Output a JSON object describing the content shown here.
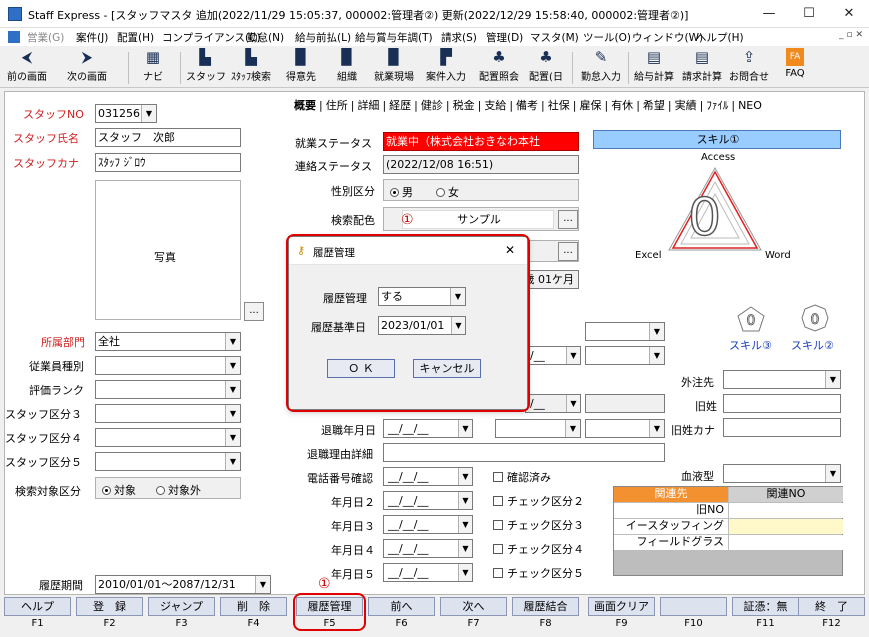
{
  "window": {
    "title": "Staff Express - [スタッフマスタ 追加(2022/11/29 15:05:37, 000002:管理者②) 更新(2022/12/29 15:58:40, 000002:管理者②)]",
    "minimize": "—",
    "maximize": "☐",
    "close": "✕"
  },
  "menu": {
    "items": [
      "営業(G)",
      "案件(J)",
      "配置(H)",
      "コンプライアンス(C)",
      "勤怠(N)",
      "給与前払(L)",
      "給与賞与年調(T)",
      "請求(S)",
      "管理(D)",
      "マスタ(M)",
      "ツール(O)",
      "ウィンドウ(W)",
      "ヘルプ(H)"
    ],
    "mdi_controls": "_ ▫ ✕"
  },
  "toolbar": {
    "prev": "前の画面",
    "next": "次の画面",
    "navi": "ナビ",
    "staff": "スタッフ",
    "staff_search": "ｽﾀｯﾌ検索",
    "client": "得意先",
    "org": "組織",
    "site": "就業現場",
    "job_entry": "案件入力",
    "assign_view": "配置照会",
    "assign_day": "配置(日",
    "attendance": "勤怠入力",
    "payroll": "給与計算",
    "billing": "請求計算",
    "inquiry": "お問合せ",
    "faq": "FAQ"
  },
  "left": {
    "staff_no_label": "スタッフNO",
    "staff_no": "031256",
    "staff_name_label": "スタッフ氏名",
    "staff_name": "スタッフ　次郎",
    "staff_kana_label": "スタッフカナ",
    "staff_kana": "ｽﾀｯﾌ ｼﾞﾛｳ",
    "photo_label": "写真",
    "photo_btn": "...",
    "dept_label": "所属部門",
    "dept": "全社",
    "emp_type_label": "従業員種別",
    "eval_rank_label": "評価ランク",
    "staff_cat3_label": "スタッフ区分３",
    "staff_cat4_label": "スタッフ区分４",
    "staff_cat5_label": "スタッフ区分５",
    "search_target_label": "検索対象区分",
    "search_target_on": "対象",
    "search_target_off": "対象外",
    "history_period_label": "履歴期間",
    "history_period": "2010/01/01～2087/12/31"
  },
  "tabs": [
    "概要",
    "住所",
    "詳細",
    "経歴",
    "健診",
    "税金",
    "支給",
    "備考",
    "社保",
    "雇保",
    "有休",
    "希望",
    "実績",
    "ﾌｧｲﾙ",
    "NEO"
  ],
  "center": {
    "work_status_label": "就業ステータス",
    "work_status": "就業中（株式会社おきなわ本社",
    "contact_status_label": "連絡ステータス",
    "contact_status": "(2022/12/08 16:51)",
    "gender_label": "性別区分",
    "gender_male": "男",
    "gender_female": "女",
    "search_color_label": "検索配色",
    "search_color": "サンプル",
    "age_partial": "歳 01ケ月",
    "retire_date_label": "退職年月日",
    "retire_reason_label": "退職理由詳細",
    "phone_confirm_label": "電話番号確認",
    "confirmed": "確認済み",
    "date2_label": "年月日２",
    "date3_label": "年月日３",
    "date4_label": "年月日４",
    "date5_label": "年月日５",
    "check2": "チェック区分２",
    "check3": "チェック区分３",
    "check4": "チェック区分４",
    "check5": "チェック区分５",
    "date_blank": "__/__/__"
  },
  "right": {
    "skill1": "スキル①",
    "access": "Access",
    "excel": "Excel",
    "word": "Word",
    "skill_value": "0",
    "skill3": "スキル③",
    "skill2": "スキル②",
    "mini_value": "0",
    "outsource_label": "外注先",
    "old_name_label": "旧姓",
    "old_kana_label": "旧姓カナ",
    "blood_label": "血液型",
    "rel_header1": "関連先",
    "rel_header2": "関連NO",
    "rel_rows": [
      "旧NO",
      "イースタッフィング",
      "フィールドグラス"
    ]
  },
  "dialog": {
    "title": "履歴管理",
    "close": "✕",
    "manage_label": "履歴管理",
    "manage_value": "する",
    "base_date_label": "履歴基準日",
    "base_date": "2023/01/01",
    "ok": "Ｏ Ｋ",
    "cancel": "キャンセル"
  },
  "annotations": {
    "marker": "①"
  },
  "fkeys": [
    {
      "label": "ヘルプ",
      "key": "F1"
    },
    {
      "label": "登　録",
      "key": "F2"
    },
    {
      "label": "ジャンプ",
      "key": "F3"
    },
    {
      "label": "削　除",
      "key": "F4"
    },
    {
      "label": "履歴管理",
      "key": "F5"
    },
    {
      "label": "前へ",
      "key": "F6"
    },
    {
      "label": "次へ",
      "key": "F7"
    },
    {
      "label": "履歴結合",
      "key": "F8"
    },
    {
      "label": "画面クリア",
      "key": "F9"
    },
    {
      "label": "",
      "key": "F10"
    },
    {
      "label": "証憑：無",
      "key": "F11"
    },
    {
      "label": "終　了",
      "key": "F12"
    }
  ],
  "colors": {
    "status_red": "#ff0000",
    "skill_blue": "#99ccff",
    "highlight_red": "#e00000",
    "rel_header": "#f39030"
  }
}
